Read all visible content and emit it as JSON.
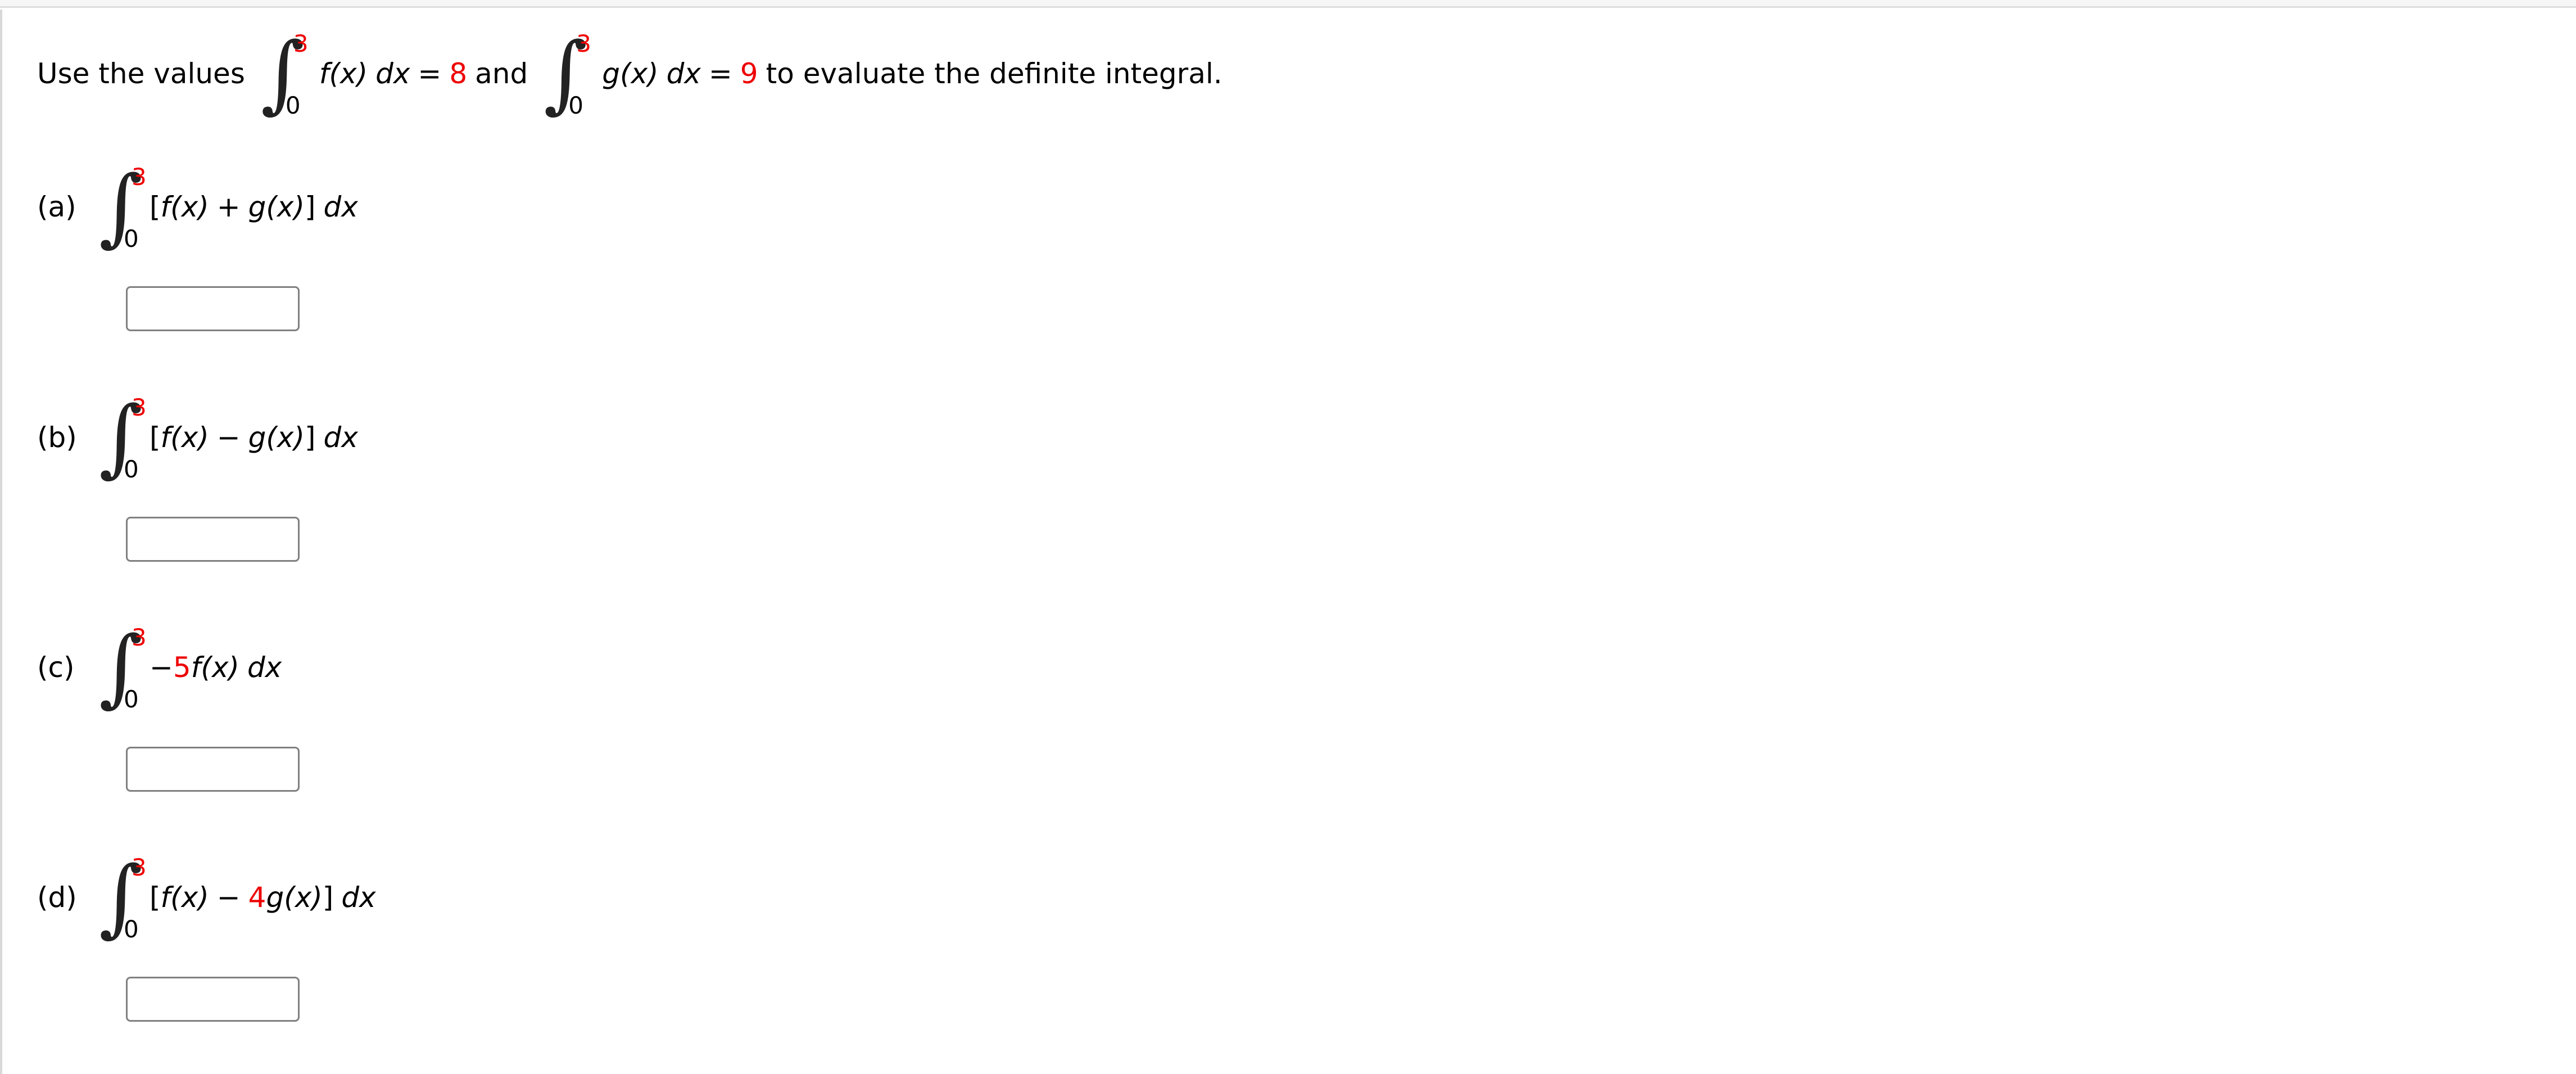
{
  "page": {
    "background_color": "#ffffff",
    "accent_red": "#ee0000",
    "border_gray": "#808080"
  },
  "prompt": {
    "lead_text": "Use the values",
    "integral_1": {
      "upper_limit": "3",
      "lower_limit": "0",
      "integrand": "f(x)",
      "differential": "dx"
    },
    "equals_1": "=",
    "value_1": "8",
    "conjunction": "and",
    "integral_2": {
      "upper_limit": "3",
      "lower_limit": "0",
      "integrand": "g(x)",
      "differential": "dx"
    },
    "equals_2": "=",
    "value_2": "9",
    "tail_text": "to evaluate the definite integral."
  },
  "parts": [
    {
      "label": "(a)",
      "upper_limit": "3",
      "lower_limit": "0",
      "expr_open": "[",
      "term_1": "f(x)",
      "operator": "+",
      "coefficient": "",
      "term_2": "g(x)",
      "expr_close": "]",
      "differential": "dx",
      "answer_value": "",
      "answer_placeholder": ""
    },
    {
      "label": "(b)",
      "upper_limit": "3",
      "lower_limit": "0",
      "expr_open": "[",
      "term_1": "f(x)",
      "operator": "−",
      "coefficient": "",
      "term_2": "g(x)",
      "expr_close": "]",
      "differential": "dx",
      "answer_value": "",
      "answer_placeholder": ""
    },
    {
      "label": "(c)",
      "upper_limit": "3",
      "lower_limit": "0",
      "expr_open": "",
      "term_1": "",
      "operator": "−",
      "coefficient": "5",
      "term_2": "f(x)",
      "expr_close": "",
      "differential": "dx",
      "answer_value": "",
      "answer_placeholder": ""
    },
    {
      "label": "(d)",
      "upper_limit": "3",
      "lower_limit": "0",
      "expr_open": "[",
      "term_1": "f(x)",
      "operator": "−",
      "coefficient": "4",
      "term_2": "g(x)",
      "expr_close": "]",
      "differential": "dx",
      "answer_value": "",
      "answer_placeholder": ""
    }
  ],
  "glyphs": {
    "integral_sign": "∫"
  }
}
